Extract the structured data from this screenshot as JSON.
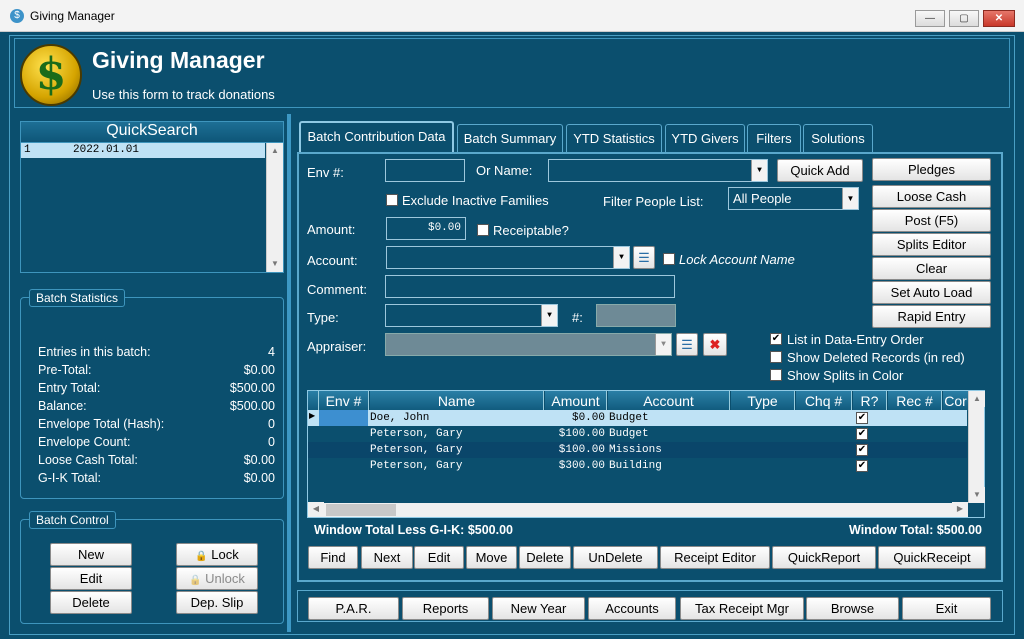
{
  "window": {
    "title": "Giving Manager",
    "min": "—",
    "max": "▢",
    "close": "✕"
  },
  "header": {
    "title": "Giving Manager",
    "subtitle": "Use this form to track donations",
    "logo_glyph": "$"
  },
  "quicksearch": {
    "title": "QuickSearch",
    "rows": [
      {
        "num": "1",
        "date": "2022.01.01"
      }
    ]
  },
  "batch_statistics": {
    "title": "Batch Statistics",
    "items": [
      {
        "label": "Entries in this batch:",
        "value": "4"
      },
      {
        "label": "Pre-Total:",
        "value": "$0.00"
      },
      {
        "label": "Entry Total:",
        "value": "$500.00"
      },
      {
        "label": "Balance:",
        "value": "$500.00"
      },
      {
        "label": "Envelope Total (Hash):",
        "value": "0"
      },
      {
        "label": "Envelope Count:",
        "value": "0"
      },
      {
        "label": "Loose Cash Total:",
        "value": "$0.00"
      },
      {
        "label": "G-I-K Total:",
        "value": "$0.00"
      }
    ]
  },
  "batch_control": {
    "title": "Batch Control",
    "new": "New",
    "edit": "Edit",
    "delete": "Delete",
    "lock": "Lock",
    "unlock": "Unlock",
    "dep_slip": "Dep. Slip"
  },
  "tabs": [
    "Batch Contribution Data",
    "Batch Summary",
    "YTD Statistics",
    "YTD Givers",
    "Filters",
    "Solutions"
  ],
  "form": {
    "env_label": "Env #:",
    "env_value": "",
    "or_name_label": "Or Name:",
    "or_name_value": "",
    "quick_add": "Quick Add",
    "exclude_inactive": "Exclude Inactive Families",
    "filter_people_label": "Filter People List:",
    "filter_people_value": "All People",
    "amount_label": "Amount:",
    "amount_value": "$0.00",
    "receiptable": "Receiptable?",
    "account_label": "Account:",
    "account_value": "",
    "lock_account": "Lock Account Name",
    "comment_label": "Comment:",
    "comment_value": "",
    "type_label": "Type:",
    "type_value": "",
    "hash_label": "#:",
    "hash_value": "",
    "appraiser_label": "Appraiser:",
    "appraiser_value": "",
    "list_order": "List in Data-Entry Order",
    "show_deleted": "Show Deleted Records (in red)",
    "show_splits": "Show Splits in Color"
  },
  "side_buttons": [
    "Pledges",
    "Loose Cash",
    "Post (F5)",
    "Splits Editor",
    "Clear",
    "Set Auto Load",
    "Rapid Entry"
  ],
  "grid": {
    "headers": [
      "Env #",
      "Name",
      "Amount",
      "Account",
      "Type",
      "Chq #",
      "R?",
      "Rec #",
      "Cor"
    ],
    "rows": [
      {
        "env": "",
        "name": "Doe, John",
        "amount": "$0.00",
        "account": "Budget",
        "type": "",
        "chq": "",
        "r": true
      },
      {
        "env": "",
        "name": "Peterson, Gary",
        "amount": "$100.00",
        "account": "Budget",
        "type": "",
        "chq": "",
        "r": true
      },
      {
        "env": "",
        "name": "Peterson, Gary",
        "amount": "$100.00",
        "account": "Missions",
        "type": "",
        "chq": "",
        "r": true
      },
      {
        "env": "",
        "name": "Peterson, Gary",
        "amount": "$300.00",
        "account": "Building",
        "type": "",
        "chq": "",
        "r": true
      }
    ]
  },
  "totals": {
    "less_gik": "Window Total Less G-I-K: $500.00",
    "window_total": "Window Total: $500.00"
  },
  "grid_buttons": [
    "Find",
    "Next",
    "Edit",
    "Move",
    "Delete",
    "UnDelete",
    "Receipt Editor",
    "QuickReport",
    "QuickReceipt"
  ],
  "footer_buttons": [
    "P.A.R.",
    "Reports",
    "New Year",
    "Accounts",
    "Tax Receipt Mgr",
    "Browse",
    "Exit"
  ],
  "icons": {
    "combo": "▼",
    "check": "✔",
    "scroll_up": "▲",
    "scroll_down": "▼",
    "scroll_left": "◀",
    "scroll_right": "▶",
    "row_pointer": "▶",
    "lock": "🔒",
    "clear": "✖",
    "list": "☰"
  }
}
